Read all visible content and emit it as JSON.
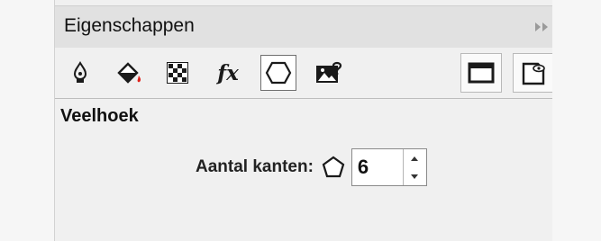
{
  "panel": {
    "title": "Eigenschappen",
    "collapse_icon": "double-chevron-right-icon"
  },
  "toolbar": {
    "tools": [
      {
        "name": "pen-outline",
        "icon": "pen-nib-icon",
        "selected": false
      },
      {
        "name": "fill",
        "icon": "fill-bucket-icon",
        "selected": false
      },
      {
        "name": "transparency",
        "icon": "checkerboard-icon",
        "selected": false
      },
      {
        "name": "effects",
        "icon": "fx-icon",
        "label": "fx",
        "selected": false
      },
      {
        "name": "polygon",
        "icon": "hexagon-icon",
        "selected": true
      },
      {
        "name": "image",
        "icon": "image-question-icon",
        "selected": false
      }
    ],
    "right_tools": [
      {
        "name": "frame",
        "icon": "frame-icon"
      },
      {
        "name": "preview",
        "icon": "page-eye-icon"
      }
    ]
  },
  "section": {
    "title": "Veelhoek",
    "sides_field": {
      "label": "Aantal kanten:",
      "icon": "pentagon-icon",
      "value": "6"
    }
  },
  "colors": {
    "fill_accent": "#e0221b",
    "panel_bg": "#f0f0f0",
    "titlebar_bg": "#e1e1e1"
  }
}
